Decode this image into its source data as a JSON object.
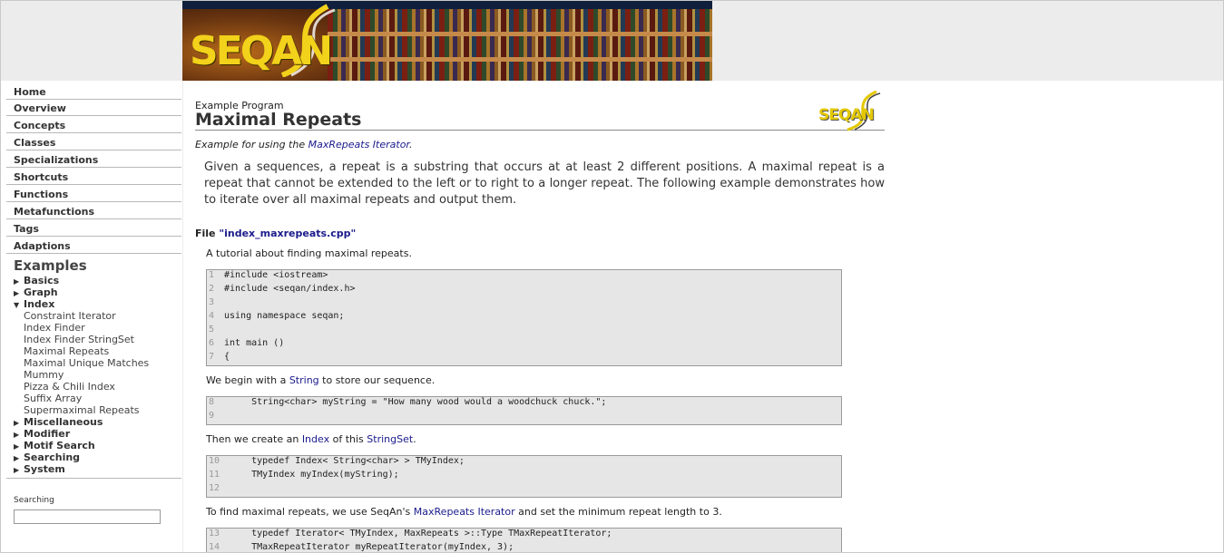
{
  "banner": {
    "logo": "SEQAN"
  },
  "sidebar": {
    "nav": [
      "Home",
      "Overview",
      "Concepts",
      "Classes",
      "Specializations",
      "Shortcuts",
      "Functions",
      "Metafunctions",
      "Tags",
      "Adaptions"
    ],
    "examples_heading": "Examples",
    "tree": [
      {
        "label": "Basics",
        "expanded": false
      },
      {
        "label": "Graph",
        "expanded": false
      },
      {
        "label": "Index",
        "expanded": true
      }
    ],
    "index_children": [
      "Constraint Iterator",
      "Index Finder",
      "Index Finder StringSet",
      "Maximal Repeats",
      "Maximal Unique Matches",
      "Mummy",
      "Pizza & Chili Index",
      "Suffix Array",
      "Supermaximal Repeats"
    ],
    "tree_after": [
      "Miscellaneous",
      "Modifier",
      "Motif Search",
      "Searching",
      "System"
    ],
    "search_label": "Searching",
    "search_value": ""
  },
  "content": {
    "subtitle": "Example Program",
    "title": "Maximal Repeats",
    "mini_logo": "SEQAN",
    "intro_prefix": "Example for using the ",
    "intro_link": "MaxRepeats Iterator",
    "intro_suffix": ".",
    "description": "Given a sequences, a repeat is a substring that occurs at at least 2 different positions. A maximal repeat is a repeat that cannot be extended to the left or to right to a longer repeat. The following example demonstrates how to iterate over all maximal repeats and output them.",
    "file_prefix": "File ",
    "file_link": "\"index_maxrepeats.cpp\"",
    "tutorial": "A tutorial about finding maximal repeats.",
    "code1": [
      {
        "n": "1",
        "t": "#include <iostream>"
      },
      {
        "n": "2",
        "t": "#include <seqan/index.h>"
      },
      {
        "n": "3",
        "t": ""
      },
      {
        "n": "4",
        "t": "using namespace seqan;"
      },
      {
        "n": "5",
        "t": ""
      },
      {
        "n": "6",
        "t": "int main ()"
      },
      {
        "n": "7",
        "t": "{"
      }
    ],
    "p1_a": "We begin with a ",
    "p1_link": "String",
    "p1_b": " to store our sequence.",
    "code2": [
      {
        "n": "8",
        "t": "     String<char> myString = \"How many wood would a woodchuck chuck.\";"
      },
      {
        "n": "9",
        "t": ""
      }
    ],
    "p2_a": "Then we create an ",
    "p2_link1": "Index",
    "p2_b": " of this ",
    "p2_link2": "StringSet",
    "p2_c": ".",
    "code3": [
      {
        "n": "10",
        "t": "     typedef Index< String<char> > TMyIndex;"
      },
      {
        "n": "11",
        "t": "     TMyIndex myIndex(myString);"
      },
      {
        "n": "12",
        "t": ""
      }
    ],
    "p3_a": "To find maximal repeats, we use SeqAn's ",
    "p3_link": "MaxRepeats Iterator",
    "p3_b": " and set the minimum repeat length to 3.",
    "code4": [
      {
        "n": "13",
        "t": "     typedef Iterator< TMyIndex, MaxRepeats >::Type TMaxRepeatIterator;"
      },
      {
        "n": "14",
        "t": "     TMaxRepeatIterator myRepeatIterator(myIndex, 3);"
      }
    ]
  }
}
